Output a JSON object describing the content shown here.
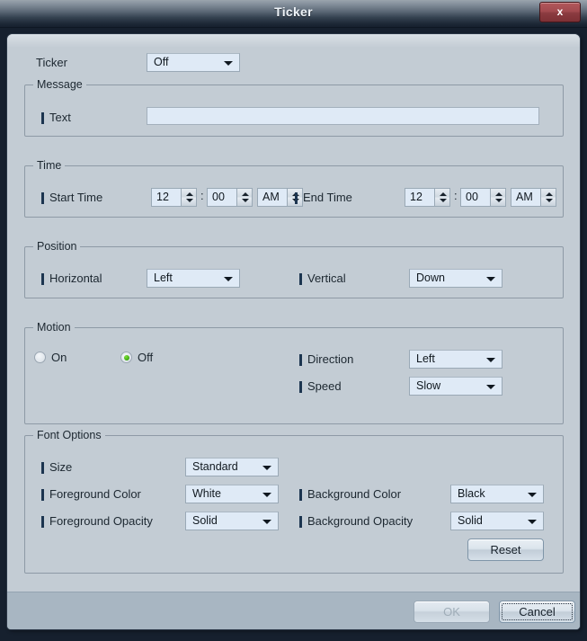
{
  "window": {
    "title": "Ticker",
    "close_label": "x"
  },
  "ticker": {
    "label": "Ticker",
    "value": "Off"
  },
  "message": {
    "group_title": "Message",
    "text_label": "Text",
    "text_value": "",
    "text_placeholder": ""
  },
  "time": {
    "group_title": "Time",
    "start_label": "Start Time",
    "start_hour": "12",
    "start_minute": "00",
    "start_meridiem": "AM",
    "end_label": "End Time",
    "end_hour": "12",
    "end_minute": "00",
    "end_meridiem": "AM",
    "separator": ":"
  },
  "position": {
    "group_title": "Position",
    "horizontal_label": "Horizontal",
    "horizontal_value": "Left",
    "vertical_label": "Vertical",
    "vertical_value": "Down"
  },
  "motion": {
    "group_title": "Motion",
    "on_label": "On",
    "off_label": "Off",
    "selected": "Off",
    "direction_label": "Direction",
    "direction_value": "Left",
    "speed_label": "Speed",
    "speed_value": "Slow"
  },
  "font_options": {
    "group_title": "Font Options",
    "size_label": "Size",
    "size_value": "Standard",
    "foreground_color_label": "Foreground Color",
    "foreground_color_value": "White",
    "background_color_label": "Background Color",
    "background_color_value": "Black",
    "foreground_opacity_label": "Foreground Opacity",
    "foreground_opacity_value": "Solid",
    "background_opacity_label": "Background Opacity",
    "background_opacity_value": "Solid",
    "reset_label": "Reset"
  },
  "footer": {
    "ok_label": "OK",
    "cancel_label": "Cancel"
  },
  "colors": {
    "panel_bg": "#c3ccd4",
    "footer_bg": "#a8b6c2",
    "field_bg": "#dfeaf6",
    "accent_marker": "#1c3550",
    "radio_on": "#3ba80f",
    "close_red": "#a24a4f",
    "title_text": "#eef3f8"
  }
}
